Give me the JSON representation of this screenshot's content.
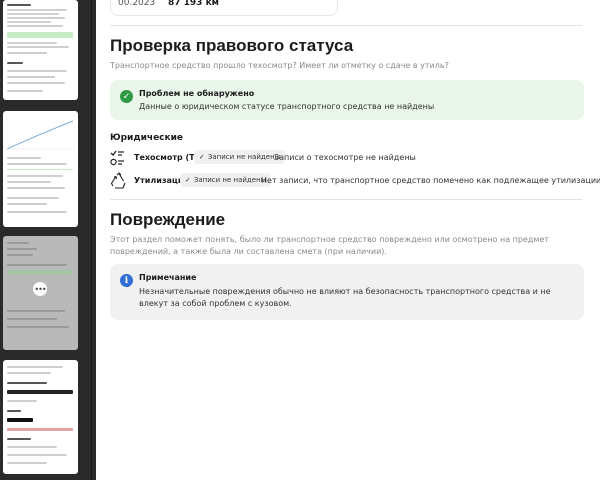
{
  "previous_row": {
    "date": "00.2023",
    "mileage": "87 193 км"
  },
  "legal": {
    "title": "Проверка правового статуса",
    "subtitle": "Транспортное средство прошло техосмотр? Имеет ли отметку о сдаче в утиль?",
    "status": {
      "title": "Проблем не обнаружено",
      "text": "Данные о юридическом статусе транспортного средства не найдены",
      "icon": "check-circle-icon",
      "color": "#2f9a45"
    },
    "group_label": "Юридические",
    "rows": [
      {
        "icon": "inspection-checklist-icon",
        "label": "Техосмотр (ТО)",
        "badge": "Записи не найдены",
        "text": "Записи о техосмотре не найдены"
      },
      {
        "icon": "recycle-icon",
        "label": "Утилизация",
        "badge": "Записи не найдены",
        "text": "Нет записи, что транспортное средство помечено как подлежащее утилизации"
      }
    ]
  },
  "damage": {
    "title": "Повреждение",
    "subtitle": "Этот раздел поможет понять, было ли транспортное средство повреждено или осмотрено на предмет повреждений, а также была ли составлена смета (при наличии).",
    "note": {
      "title": "Примечание",
      "text": "Незначительные повреждения обычно не влияют на безопасность транспортного средства и не влекут за собой проблем с кузовом.",
      "icon": "info-icon",
      "color": "#2f6fd6"
    }
  },
  "thumbnails": {
    "more_icon": "more-dots-icon"
  }
}
